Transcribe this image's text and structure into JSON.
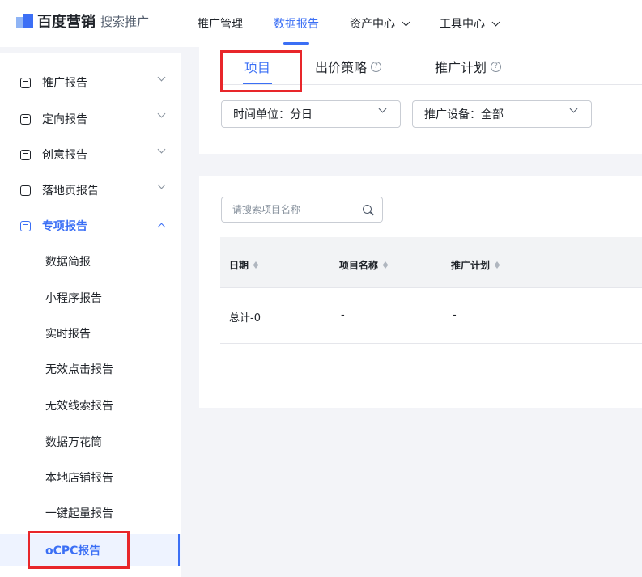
{
  "logo": {
    "brand": "百度营销",
    "sub": "搜索推广"
  },
  "nav": [
    {
      "label": "推广管理"
    },
    {
      "label": "数据报告"
    },
    {
      "label": "资产中心"
    },
    {
      "label": "工具中心"
    }
  ],
  "sidebar": {
    "groups": [
      {
        "label": "推广报告"
      },
      {
        "label": "定向报告"
      },
      {
        "label": "创意报告"
      },
      {
        "label": "落地页报告"
      },
      {
        "label": "专项报告"
      }
    ],
    "sub_items": [
      {
        "label": "数据简报"
      },
      {
        "label": "小程序报告"
      },
      {
        "label": "实时报告"
      },
      {
        "label": "无效点击报告"
      },
      {
        "label": "无效线索报告"
      },
      {
        "label": "数据万花筒"
      },
      {
        "label": "本地店铺报告"
      },
      {
        "label": "一键起量报告"
      },
      {
        "label": "oCPC报告"
      }
    ]
  },
  "tabs": [
    {
      "label": "项目"
    },
    {
      "label": "出价策略"
    },
    {
      "label": "推广计划"
    }
  ],
  "filters": {
    "time_unit": "时间单位：分日",
    "device": "推广设备：全部"
  },
  "search": {
    "placeholder": "请搜索项目名称"
  },
  "table": {
    "headers": [
      "日期",
      "项目名称",
      "推广计划"
    ],
    "rows": [
      [
        "总计-0",
        "-",
        "-"
      ]
    ]
  },
  "colors": {
    "accent": "#3b6ff5",
    "highlight": "#e8262a"
  }
}
